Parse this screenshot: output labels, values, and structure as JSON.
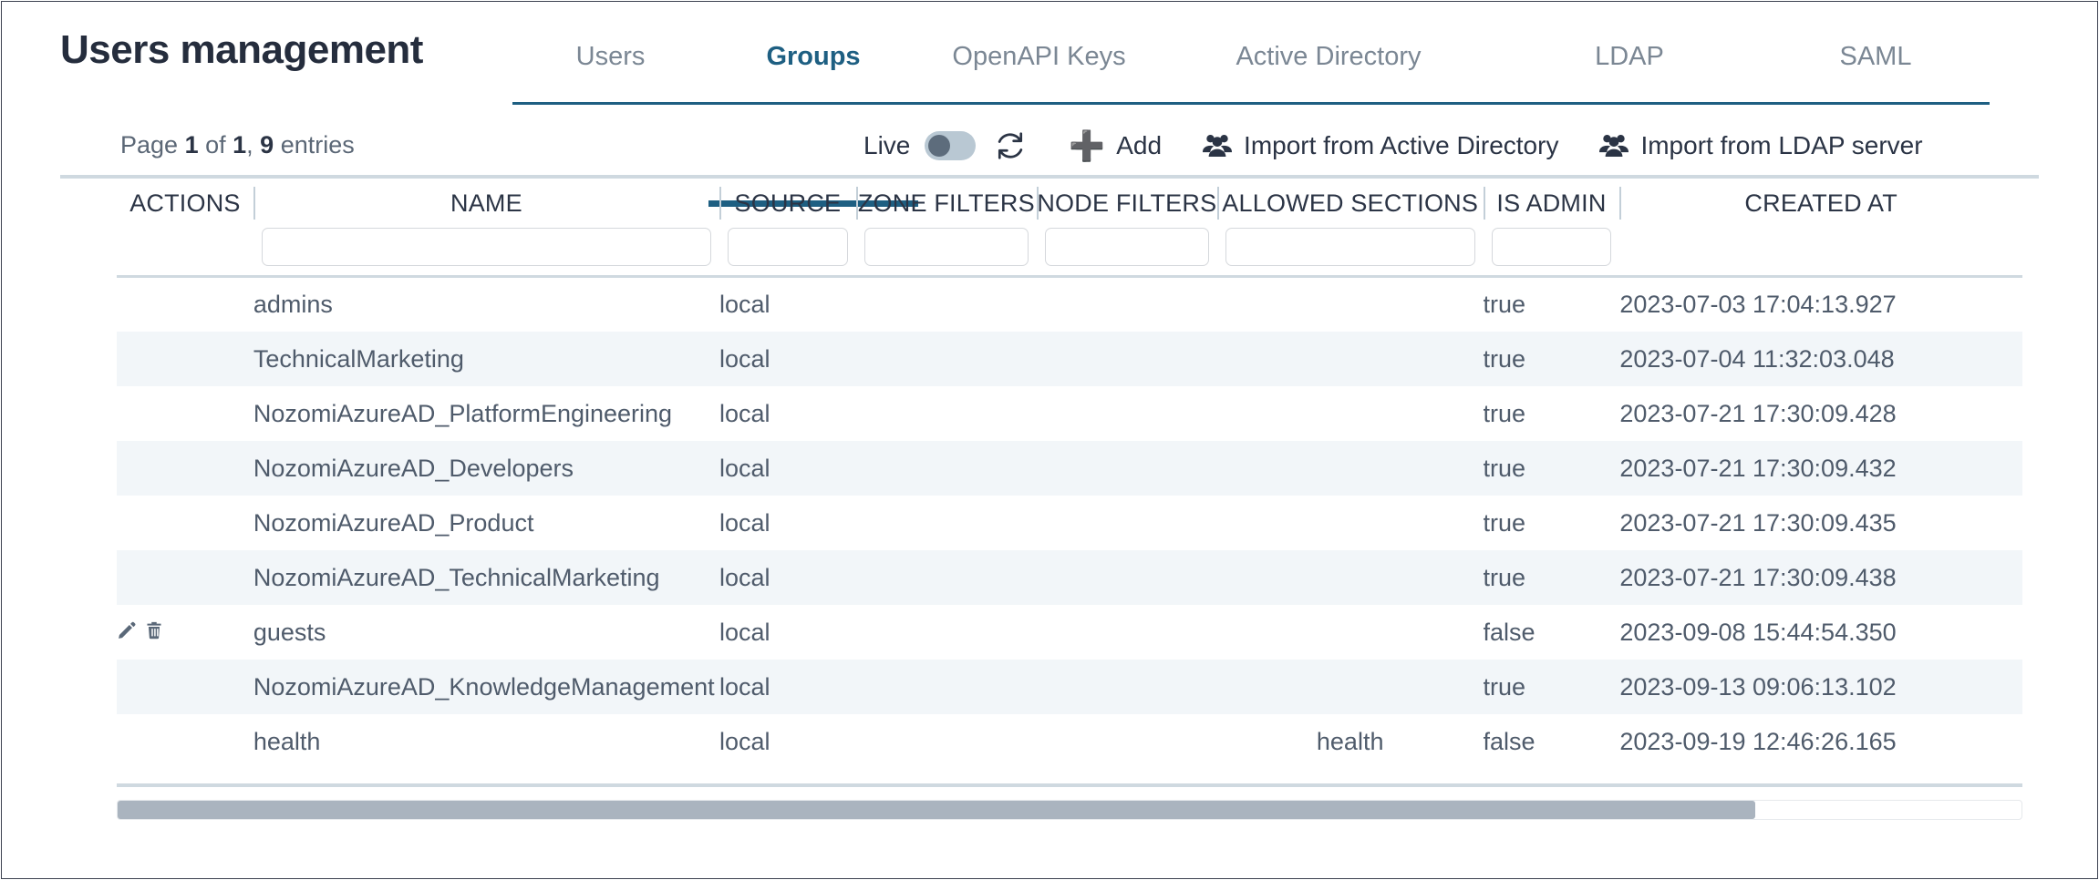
{
  "header": {
    "title": "Users management",
    "tabs": [
      {
        "label": "Users",
        "active": false
      },
      {
        "label": "Groups",
        "active": true
      },
      {
        "label": "OpenAPI Keys",
        "active": false
      },
      {
        "label": "Active Directory",
        "active": false
      },
      {
        "label": "LDAP",
        "active": false
      },
      {
        "label": "SAML",
        "active": false
      }
    ]
  },
  "toolbar": {
    "pager_prefix": "Page ",
    "pager_page": "1",
    "pager_of": " of ",
    "pager_total_pages": "1",
    "pager_comma": ", ",
    "pager_entries_count": "9",
    "pager_entries_suffix": " entries",
    "live_label": "Live",
    "live_enabled": false,
    "refresh_icon": "refresh-icon",
    "add_label": "Add",
    "add_icon": "plus-icon",
    "import_ad_label": "Import from Active Directory",
    "import_ad_icon": "users-group-icon",
    "import_ldap_label": "Import from LDAP server",
    "import_ldap_icon": "users-group-icon"
  },
  "table": {
    "columns": [
      {
        "key": "actions",
        "label": "ACTIONS",
        "filterable": false
      },
      {
        "key": "name",
        "label": "NAME",
        "filterable": true
      },
      {
        "key": "source",
        "label": "SOURCE",
        "filterable": true
      },
      {
        "key": "zone",
        "label": "ZONE FILTERS",
        "filterable": true
      },
      {
        "key": "node",
        "label": "NODE FILTERS",
        "filterable": true
      },
      {
        "key": "sections",
        "label": "ALLOWED SECTIONS",
        "filterable": true
      },
      {
        "key": "isadmin",
        "label": "IS ADMIN",
        "filterable": true
      },
      {
        "key": "created",
        "label": "CREATED AT",
        "filterable": false
      }
    ],
    "filters": {
      "name": "",
      "source": "",
      "zone": "",
      "node": "",
      "sections": "",
      "isadmin": ""
    },
    "rows": [
      {
        "actions": [],
        "name": "admins",
        "source": "local",
        "zone": "",
        "node": "",
        "sections": "",
        "isadmin": "true",
        "created": "2023-07-03 17:04:13.927"
      },
      {
        "actions": [],
        "name": "TechnicalMarketing",
        "source": "local",
        "zone": "",
        "node": "",
        "sections": "",
        "isadmin": "true",
        "created": "2023-07-04 11:32:03.048"
      },
      {
        "actions": [],
        "name": "NozomiAzureAD_PlatformEngineering",
        "source": "local",
        "zone": "",
        "node": "",
        "sections": "",
        "isadmin": "true",
        "created": "2023-07-21 17:30:09.428"
      },
      {
        "actions": [],
        "name": "NozomiAzureAD_Developers",
        "source": "local",
        "zone": "",
        "node": "",
        "sections": "",
        "isadmin": "true",
        "created": "2023-07-21 17:30:09.432"
      },
      {
        "actions": [],
        "name": "NozomiAzureAD_Product",
        "source": "local",
        "zone": "",
        "node": "",
        "sections": "",
        "isadmin": "true",
        "created": "2023-07-21 17:30:09.435"
      },
      {
        "actions": [],
        "name": "NozomiAzureAD_TechnicalMarketing",
        "source": "local",
        "zone": "",
        "node": "",
        "sections": "",
        "isadmin": "true",
        "created": "2023-07-21 17:30:09.438"
      },
      {
        "actions": [
          "edit-icon",
          "delete-icon"
        ],
        "name": "guests",
        "source": "local",
        "zone": "",
        "node": "",
        "sections": "",
        "isadmin": "false",
        "created": "2023-09-08 15:44:54.350"
      },
      {
        "actions": [],
        "name": "NozomiAzureAD_KnowledgeManagement",
        "source": "local",
        "zone": "",
        "node": "",
        "sections": "",
        "isadmin": "true",
        "created": "2023-09-13 09:06:13.102"
      },
      {
        "actions": [],
        "name": "health",
        "source": "local",
        "zone": "",
        "node": "",
        "sections": "health",
        "isadmin": "false",
        "created": "2023-09-19 12:46:26.165"
      }
    ]
  },
  "scrollbar": {
    "orientation": "horizontal",
    "thumb_percent": 86
  },
  "colors": {
    "accent": "#1e5f82",
    "text": "#2b3445",
    "muted": "#7b8794",
    "row_alt": "#f2f6f9",
    "rule": "#cfd9e0",
    "toggle_track": "#b9c8d3",
    "toggle_knob": "#5d6c7c",
    "scroll_thumb": "#aab4bf"
  }
}
